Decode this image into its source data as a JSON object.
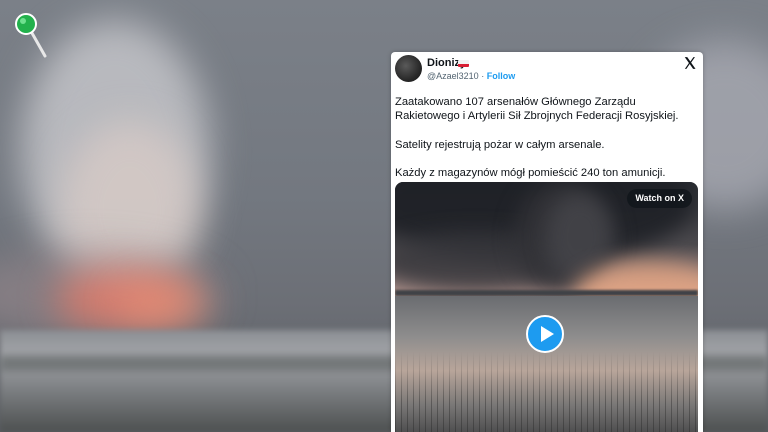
{
  "tweet": {
    "author_name": "Dionizy",
    "handle": "@Azael3210",
    "separator": "·",
    "follow_label": "Follow",
    "paragraphs": [
      "Zaatakowano 107 arsenałów Głównego Zarządu Rakietowego i Artylerii Sił Zbrojnych Federacji Rosyjskiej.",
      "Satelity rejestrują pożar w całym arsenale.",
      "Każdy z magazynów mógł pomieścić 240 ton amunicji."
    ],
    "video": {
      "watch_label": "Watch on X"
    }
  },
  "icons": {
    "pin": "map-pin-icon",
    "platform": "x-logo-icon",
    "play": "play-icon",
    "flag": "poland-flag-icon"
  },
  "colors": {
    "accent": "#1d9bf0",
    "pin_green": "#22b14c",
    "text": "#0f1419",
    "muted": "#536471"
  }
}
